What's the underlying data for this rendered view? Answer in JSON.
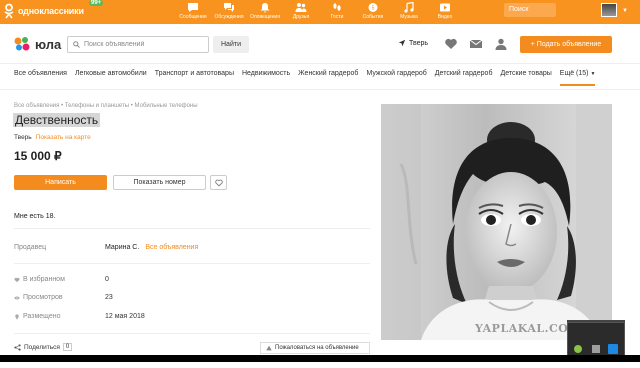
{
  "ok_bar": {
    "logo_text": "одноклассники",
    "badge": "99+",
    "nav": [
      {
        "label": "Сообщения",
        "icon": "chat-icon"
      },
      {
        "label": "Обсуждения",
        "icon": "discussion-icon"
      },
      {
        "label": "Оповещения",
        "icon": "bell-icon"
      },
      {
        "label": "Друзья",
        "icon": "friends-icon"
      },
      {
        "label": "Гости",
        "icon": "footprints-icon"
      },
      {
        "label": "События",
        "icon": "events-icon"
      },
      {
        "label": "Музыка",
        "icon": "music-icon"
      },
      {
        "label": "Видео",
        "icon": "video-icon"
      }
    ],
    "search_placeholder": "Поиск"
  },
  "header": {
    "logo_text": "юла",
    "search_placeholder": "Поиск объявлений",
    "find_label": "Найти",
    "city": "Тверь",
    "post_label": "+ Подать объявление"
  },
  "categories": [
    "Все объявления",
    "Легковые автомобили",
    "Транспорт и автотовары",
    "Недвижимость",
    "Женский гардероб",
    "Мужской гардероб",
    "Детский гардероб",
    "Детские товары",
    "Ещё (15)"
  ],
  "listing": {
    "breadcrumbs": "Все объявления  •  Телефоны и планшеты  •  Мобильные телефоны",
    "title": "Девственность",
    "city": "Тверь",
    "map_link": "Показать на карте",
    "price": "15 000 ₽",
    "write_label": "Написать",
    "phone_label": "Показать номер",
    "description": "Мне есть 18.",
    "seller_label": "Продавец",
    "seller_name": "Марина С.",
    "seller_all": "Все объявления",
    "stats": [
      {
        "label": "В избранном",
        "value": "0",
        "icon": "heart-icon"
      },
      {
        "label": "Просмотров",
        "value": "23",
        "icon": "eye-icon"
      },
      {
        "label": "Размещено",
        "value": "12 мая 2018",
        "icon": "pin-icon"
      }
    ],
    "share_label": "Поделиться",
    "share_count": "0",
    "complain_label": "Пожаловаться на объявление"
  },
  "watermark": "YAPLAKAL.COM",
  "colors": {
    "ok_orange": "#f7931e",
    "accent": "#f48b1f"
  }
}
